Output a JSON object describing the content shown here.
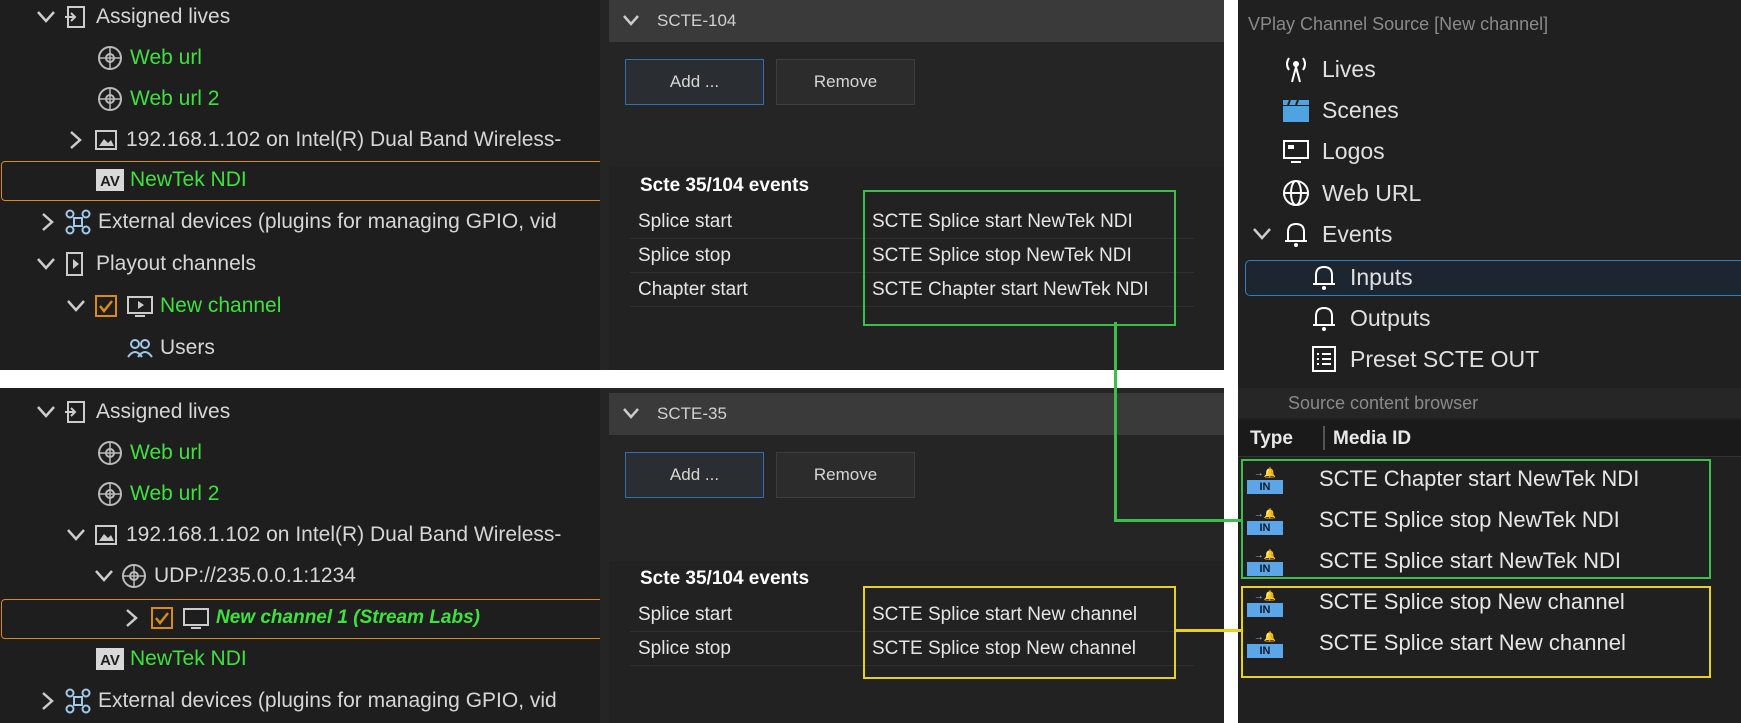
{
  "colors": {
    "green_text": "#3fe03f",
    "selection": "#d98a1a",
    "green_box": "#3cbf4a",
    "yellow_box": "#e6d21e",
    "accent_blue": "#2e6fb0"
  },
  "top_tree": {
    "assigned_lives": "Assigned lives",
    "web_url": "Web url",
    "web_url_2": "Web url 2",
    "network_source": "192.168.1.102 on Intel(R) Dual Band Wireless-",
    "newtek_ndi": "NewTek NDI",
    "external_devices": "External devices (plugins for managing GPIO, vid",
    "playout_channels": "Playout channels",
    "new_channel": "New channel",
    "users": "Users"
  },
  "bottom_tree": {
    "assigned_lives": "Assigned lives",
    "web_url": "Web url",
    "web_url_2": "Web url 2",
    "network_source": "192.168.1.102 on Intel(R) Dual Band Wireless-",
    "udp_source": "UDP://235.0.0.1:1234",
    "new_channel_1": "New channel 1 (Stream Labs)",
    "newtek_ndi": "NewTek NDI",
    "external_devices": "External devices (plugins for managing GPIO, vid"
  },
  "scte104": {
    "header": "SCTE-104",
    "add_label": "Add ...",
    "remove_label": "Remove",
    "events_title": "Scte 35/104 events",
    "events": [
      {
        "name": "Splice start",
        "value": "SCTE Splice start NewTek NDI"
      },
      {
        "name": "Splice stop",
        "value": "SCTE Splice stop NewTek NDI"
      },
      {
        "name": "Chapter start",
        "value": "SCTE Chapter start NewTek NDI"
      }
    ]
  },
  "scte35": {
    "header": "SCTE-35",
    "add_label": "Add ...",
    "remove_label": "Remove",
    "events_title": "Scte 35/104 events",
    "events": [
      {
        "name": "Splice start",
        "value": "SCTE Splice start New channel"
      },
      {
        "name": "Splice stop",
        "value": "SCTE Splice stop New channel"
      }
    ]
  },
  "source": {
    "title": "VPlay Channel Source [New channel]",
    "items": {
      "lives": "Lives",
      "scenes": "Scenes",
      "logos": "Logos",
      "web_url": "Web URL",
      "events": "Events",
      "inputs": "Inputs",
      "outputs": "Outputs",
      "preset": "Preset SCTE OUT"
    },
    "browser_title": "Source content browser",
    "col_type": "Type",
    "col_media_id": "Media ID",
    "badge_text": "IN",
    "media": [
      "SCTE Chapter start NewTek NDI",
      "SCTE Splice stop NewTek NDI",
      "SCTE Splice start NewTek NDI",
      "SCTE Splice stop New channel",
      "SCTE Splice start New channel"
    ]
  }
}
